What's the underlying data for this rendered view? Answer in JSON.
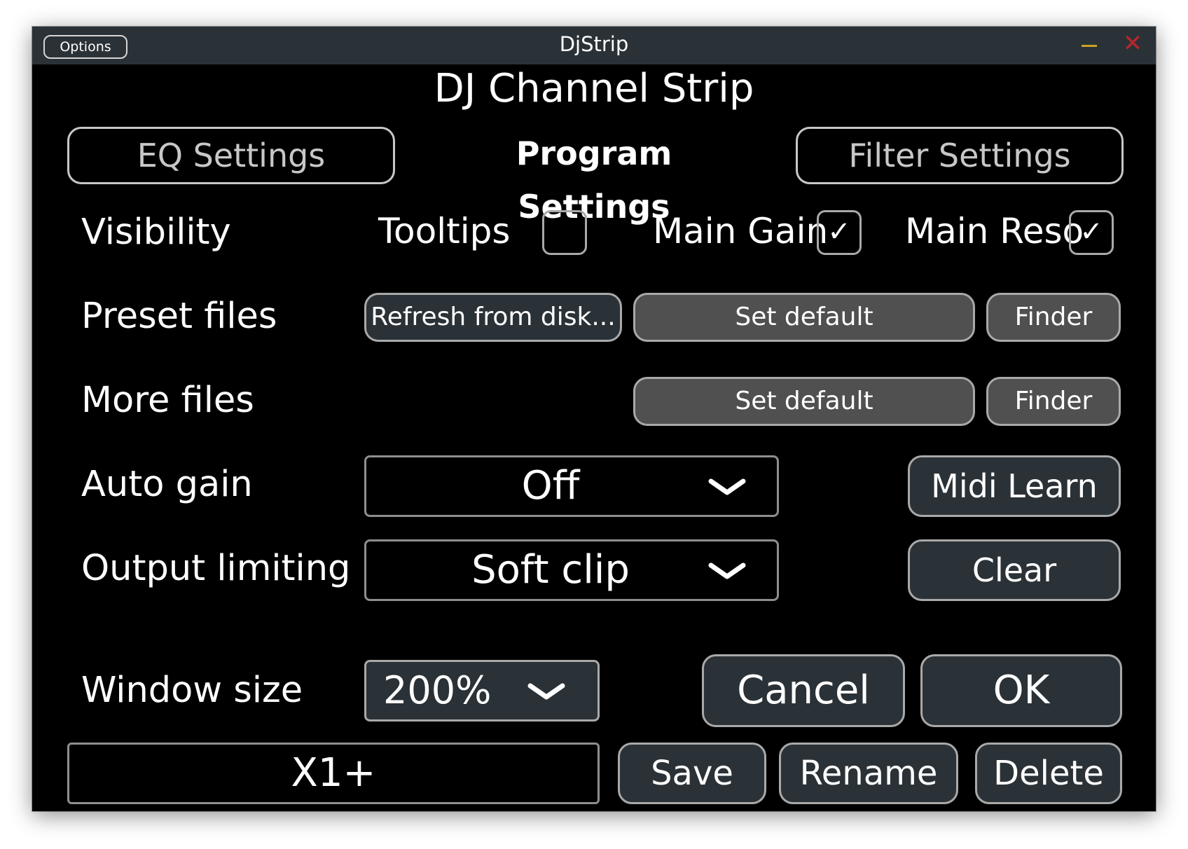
{
  "window": {
    "title": "DjStrip",
    "options_label": "Options",
    "close_glyph": "✕"
  },
  "heading": "DJ Channel Strip",
  "tabs": [
    {
      "label": "EQ Settings"
    },
    {
      "label": "Program Settings",
      "active": true
    },
    {
      "label": "Filter Settings"
    }
  ],
  "visibility": {
    "label": "Visibility",
    "checkboxes": [
      {
        "label": "Tooltips",
        "checked": false,
        "mark": ""
      },
      {
        "label": "Main Gain",
        "checked": true,
        "mark": "✓"
      },
      {
        "label": "Main Reso",
        "checked": true,
        "mark": "✓"
      }
    ]
  },
  "preset_files": {
    "label": "Preset files",
    "refresh_label": "Refresh from disk...",
    "set_default_label": "Set default",
    "finder_label": "Finder"
  },
  "more_files": {
    "label": "More files",
    "set_default_label": "Set default",
    "finder_label": "Finder"
  },
  "auto_gain": {
    "label": "Auto gain",
    "value": "Off",
    "midi_learn_label": "Midi Learn"
  },
  "output_limiting": {
    "label": "Output limiting",
    "value": "Soft clip",
    "clear_label": "Clear"
  },
  "window_size": {
    "label": "Window size",
    "value": "200%",
    "cancel_label": "Cancel",
    "ok_label": "OK"
  },
  "preset": {
    "name": "X1+",
    "save_label": "Save",
    "rename_label": "Rename",
    "delete_label": "Delete"
  },
  "colors": {
    "background": "#000000",
    "titlebar": "#2b3237",
    "button_slate": "#2b3237",
    "button_grey": "#505050",
    "border": "#a9a9a9",
    "minimize": "#c9a227",
    "close": "#b8262a"
  }
}
